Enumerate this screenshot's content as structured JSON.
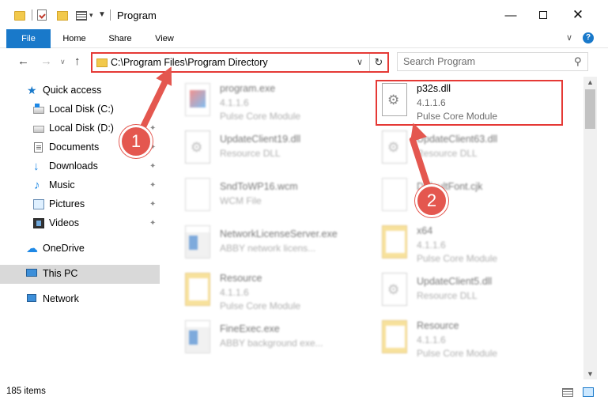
{
  "window": {
    "title": "Program",
    "minimize_glyph": "—",
    "close_glyph": "✕"
  },
  "ribbon": {
    "tabs": [
      "File",
      "Home",
      "Share",
      "View"
    ],
    "help_glyph": "?",
    "collapse_glyph": "∨"
  },
  "address": {
    "path": "C:\\Program Files\\Program Directory",
    "dropdown_glyph": "∨",
    "refresh_glyph": "↻"
  },
  "nav": {
    "back_glyph": "←",
    "forward_glyph": "→",
    "recent_glyph": "∨",
    "up_glyph": "↑"
  },
  "search": {
    "placeholder": "Search Program",
    "icon_glyph": "⚲"
  },
  "sidebar": {
    "items": [
      {
        "label": "Quick access",
        "icon": "star-icon",
        "pinned": false
      },
      {
        "label": "Local Disk (C:)",
        "icon": "drive-icon",
        "pinned": false
      },
      {
        "label": "Local Disk (D:)",
        "icon": "drive-icon",
        "pinned": true
      },
      {
        "label": "Documents",
        "icon": "documents-icon",
        "pinned": true
      },
      {
        "label": "Downloads",
        "icon": "download-icon",
        "pinned": true
      },
      {
        "label": "Music",
        "icon": "music-icon",
        "pinned": true
      },
      {
        "label": "Pictures",
        "icon": "pictures-icon",
        "pinned": true
      },
      {
        "label": "Videos",
        "icon": "videos-icon",
        "pinned": true
      },
      {
        "label": "OneDrive",
        "icon": "cloud-icon",
        "pinned": false
      },
      {
        "label": "This PC",
        "icon": "computer-icon",
        "pinned": false,
        "selected": true
      },
      {
        "label": "Network",
        "icon": "network-icon",
        "pinned": false
      }
    ],
    "pin_glyph": "📌"
  },
  "files": [
    {
      "name": "program.exe",
      "version": "4.1.1.6",
      "desc": "Pulse Core Module",
      "icon": "exe-icon",
      "blurred": true
    },
    {
      "name": "p32s.dll",
      "version": "4.1.1.6",
      "desc": "Pulse Core Module",
      "icon": "dll-icon",
      "blurred": false,
      "highlighted": true
    },
    {
      "name": "UpdateClient19.dll",
      "version": "Resource DLL",
      "desc": "",
      "icon": "dll-icon",
      "blurred": true
    },
    {
      "name": "UpdateClient63.dll",
      "version": "Resource DLL",
      "desc": "",
      "icon": "dll-icon",
      "blurred": true
    },
    {
      "name": "SndToWP16.wcm",
      "version": "WCM File",
      "desc": "",
      "icon": "file-icon",
      "blurred": true
    },
    {
      "name": "DefaultFont.cjk",
      "version": "",
      "desc": "",
      "icon": "file-icon",
      "blurred": true
    },
    {
      "name": "NetworkLicenseServer.exe",
      "version": "ABBY network licens...",
      "desc": "",
      "icon": "exe-icon",
      "blurred": true
    },
    {
      "name": "x64",
      "version": "4.1.1.6",
      "desc": "Pulse Core Module",
      "icon": "folder-icon",
      "blurred": true
    },
    {
      "name": "Resource",
      "version": "4.1.1.6",
      "desc": "Pulse Core Module",
      "icon": "folder-icon",
      "blurred": true
    },
    {
      "name": "UpdateClient5.dll",
      "version": "Resource DLL",
      "desc": "",
      "icon": "dll-icon",
      "blurred": true
    },
    {
      "name": "FineExec.exe",
      "version": "ABBY background exe...",
      "desc": "",
      "icon": "exe-icon",
      "blurred": true
    },
    {
      "name": "Resource",
      "version": "4.1.1.6",
      "desc": "Pulse Core Module",
      "icon": "folder-icon",
      "blurred": true
    }
  ],
  "status": {
    "count": "185 items"
  },
  "annotations": {
    "step1": "1",
    "step2": "2",
    "color": "#e4574f"
  }
}
